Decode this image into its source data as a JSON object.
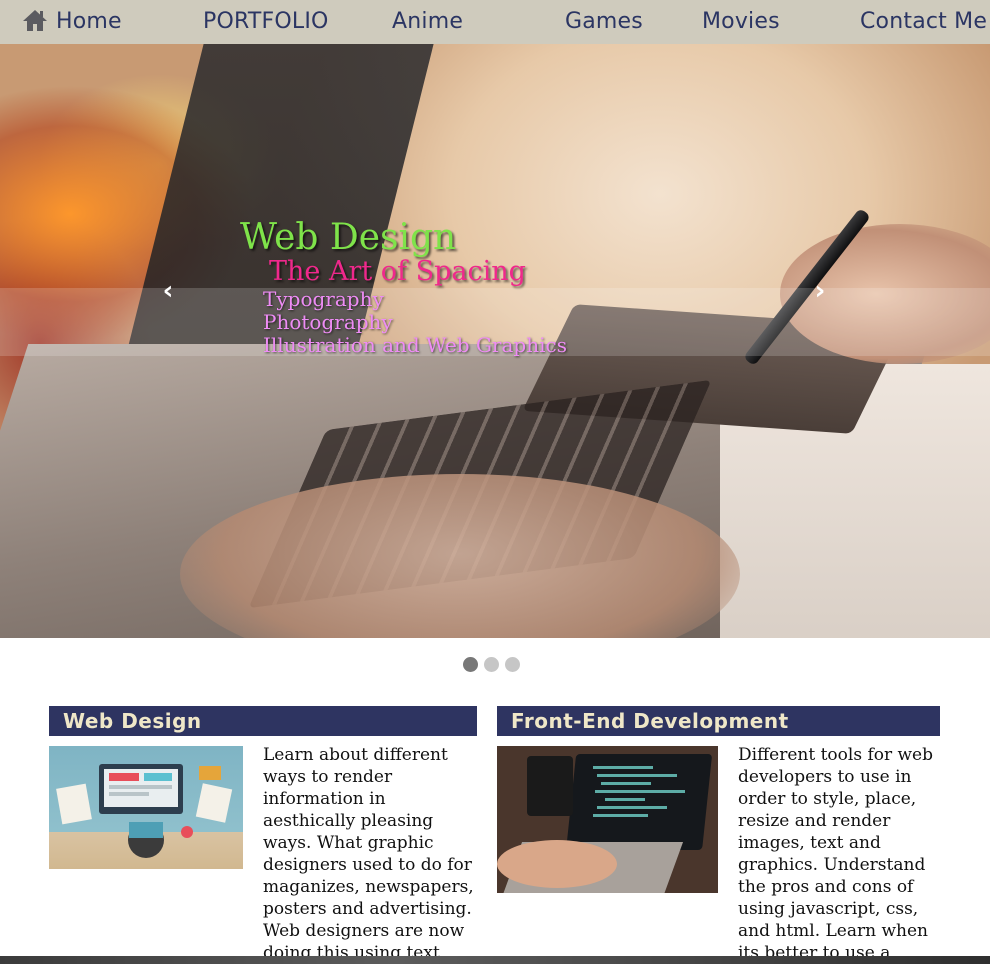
{
  "nav": {
    "items": [
      {
        "label": "Home",
        "icon": "home-icon"
      },
      {
        "label": "PORTFOLIO"
      },
      {
        "label": "Anime"
      },
      {
        "label": "Games"
      },
      {
        "label": "Movies"
      },
      {
        "label": "Contact Me"
      }
    ],
    "background": "#cfcbbd",
    "text_color": "#2b3563"
  },
  "hero": {
    "caption": {
      "title": "Web Design",
      "subtitle": "The Art of Spacing",
      "lines": [
        "Typography",
        "Photography",
        "Illustration and Web Graphics"
      ]
    },
    "prev_glyph": "‹",
    "next_glyph": "›",
    "slides": 3,
    "active_slide": 1,
    "colors": {
      "title": "#7fe34a",
      "subtitle": "#f0288c",
      "lines": "#ee8cf5"
    }
  },
  "cards": [
    {
      "title": "Web Design",
      "text": "Learn about different ways to render information in aesthically pleasing ways. What graphic designers used to do for maganizes, newspapers, posters and advertising. Web designers are now doing this using text, images and"
    },
    {
      "title": "Front-End Development",
      "text": "Different tools for web developers to use in order to style, place, resize and render images, text and graphics. Understand the pros and cons of using javascript, css, and html. Learn when its better to use a framework like"
    }
  ],
  "colors": {
    "card_header_bg": "#2e3461",
    "card_header_text": "#efe7c8"
  }
}
